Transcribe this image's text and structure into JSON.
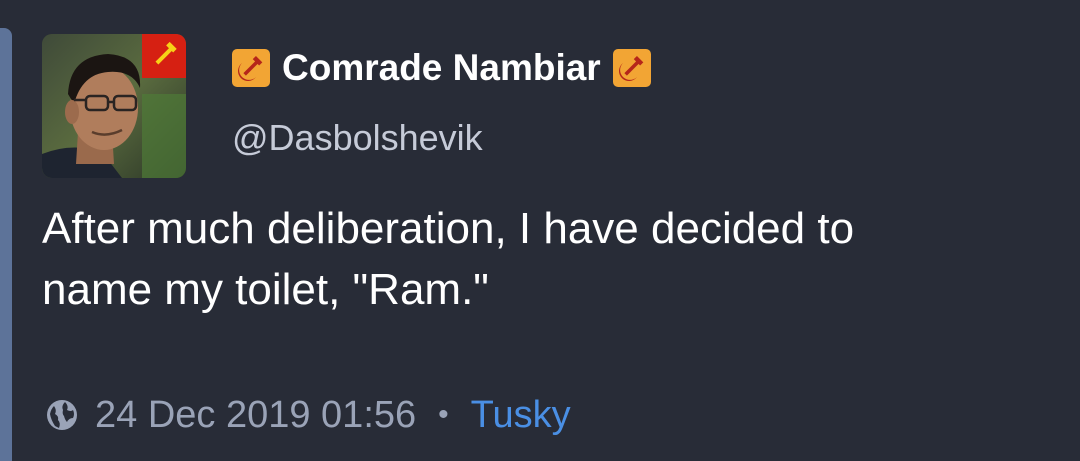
{
  "author": {
    "display_name": "Comrade Nambiar",
    "handle": "@Dasbolshevik",
    "name_emoji": "hammer-and-sickle-emoji",
    "avatar_badge": "hammer-and-sickle-flag"
  },
  "status": {
    "content_lines": [
      "After much deliberation, I have decided to",
      "name my toilet, \"Ram.\""
    ]
  },
  "meta": {
    "visibility_icon": "globe-icon",
    "timestamp": "24 Dec 2019 01:56",
    "separator": "•",
    "application": "Tusky"
  },
  "colors": {
    "background": "#282c37",
    "focus_bar": "#5d7399",
    "text_primary": "#ffffff",
    "text_secondary": "#9aa3b7",
    "link": "#4a8fe4",
    "emoji_bg": "#f2a534",
    "flag_red": "#d62012"
  }
}
